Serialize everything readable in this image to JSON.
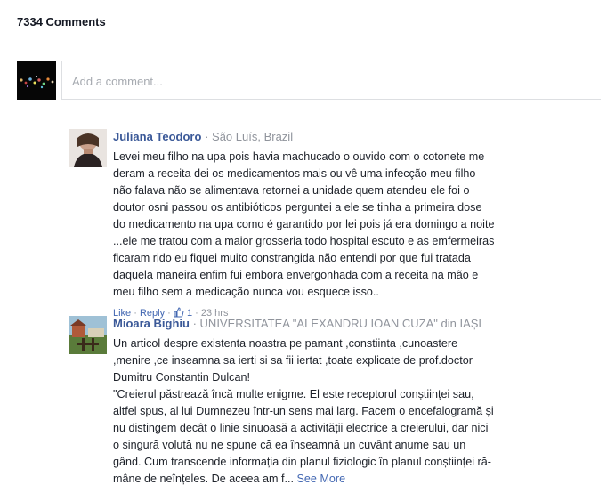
{
  "header": {
    "comment_count": "7334 Comments"
  },
  "composer": {
    "placeholder": "Add a comment..."
  },
  "comments": [
    {
      "author": "Juliana Teodoro",
      "separator": "·",
      "location": "São Luís, Brazil",
      "lines": [
        "Levei meu filho na upa pois havia machucado o ouvido com o cotonete me",
        "deram a receita dei os medicamentos mais ou vê uma infecção meu filho",
        "não falava não se alimentava retornei a unidade quem atendeu ele foi o",
        "doutor osni passou os antibióticos perguntei a ele se tinha a primeira dose",
        "do medicamento na upa como é garantido por lei pois já era domingo a noite",
        "...ele me tratou com a maior grosseria todo hospital escuto e as emfermeiras",
        "ficaram rido eu fiquei muito constrangida não entendi por que fui tratada",
        "daquela maneira enfim fui embora envergonhada com a receita na mão e",
        "meu filho sem a medicação nunca vou esquece isso.."
      ],
      "actions": {
        "like": "Like",
        "dot1": "·",
        "reply": "Reply",
        "dot2": "·",
        "like_count": "1",
        "dot3": "·",
        "time": "23 hrs"
      }
    },
    {
      "author": "Mioara Bighiu",
      "separator": "·",
      "location": "UNIVERSITATEA \"ALEXANDRU IOAN CUZA\" din IAȘI",
      "lines": [
        "Un articol despre existenta noastra pe pamant ,constiinta ,cunoastere",
        ",menire ,ce inseamna sa ierti si sa fii iertat ,toate explicate de prof.doctor",
        "Dumitru Constantin Dulcan!",
        "\"Creierul păstrează încă multe enigme. El este receptorul conștiinței sau,",
        "altfel spus, al lui Dumnezeu într-un sens mai larg. Facem o encefalogramă și",
        "nu distingem decât o linie sinuoasă a activității electrice a creierului, dar nici",
        "o singură volută nu ne spune că ea înseamnă un cuvânt anume sau un",
        "gând. Cum transcende informația din planul fiziologic în planul conștiinței ră-"
      ],
      "last_line": "mâne de neînțeles. De aceea am f...",
      "see_more": "See More"
    }
  ]
}
